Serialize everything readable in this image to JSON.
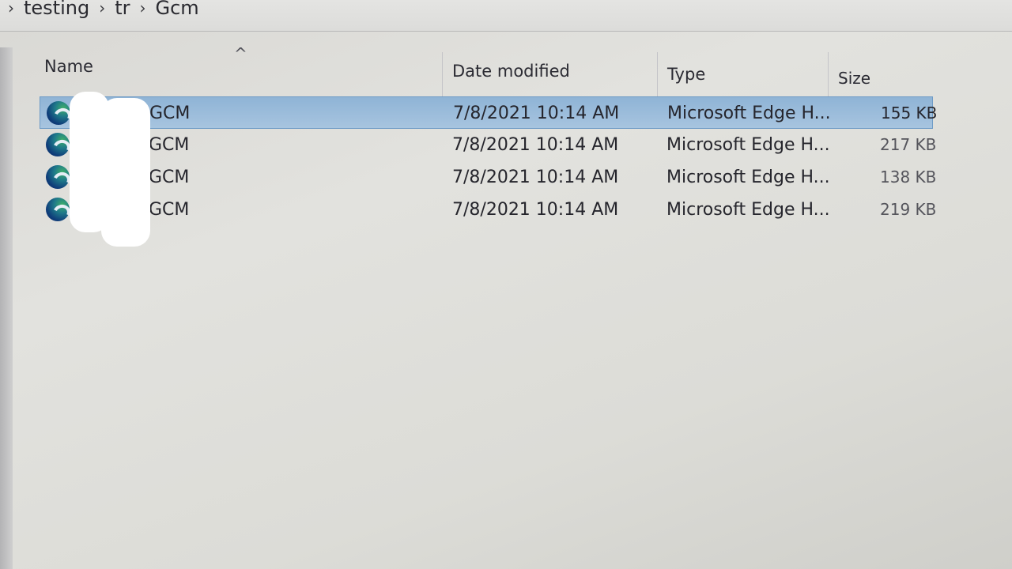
{
  "breadcrumb": {
    "items": [
      "testing",
      "tr",
      "Gcm"
    ]
  },
  "columns": {
    "name": "Name",
    "date": "Date modified",
    "type": "Type",
    "size": "Size"
  },
  "rows": [
    {
      "name": "GCM",
      "date": "7/8/2021 10:14 AM",
      "type": "Microsoft Edge H...",
      "size": "155 KB",
      "selected": true
    },
    {
      "name": "GCM",
      "date": "7/8/2021 10:14 AM",
      "type": "Microsoft Edge H...",
      "size": "217 KB",
      "selected": false
    },
    {
      "name": "GCM",
      "date": "7/8/2021 10:14 AM",
      "type": "Microsoft Edge H...",
      "size": "138 KB",
      "selected": false
    },
    {
      "name": "GCM",
      "date": "7/8/2021 10:14 AM",
      "type": "Microsoft Edge H...",
      "size": "219 KB",
      "selected": false
    }
  ],
  "icons": {
    "file_icon": "edge-browser-icon",
    "sort_icon": "sort-ascending-icon",
    "chevron": "chevron-right-icon"
  },
  "colors": {
    "selection": "#9dbddc",
    "selection_border": "#6e9bc6"
  }
}
